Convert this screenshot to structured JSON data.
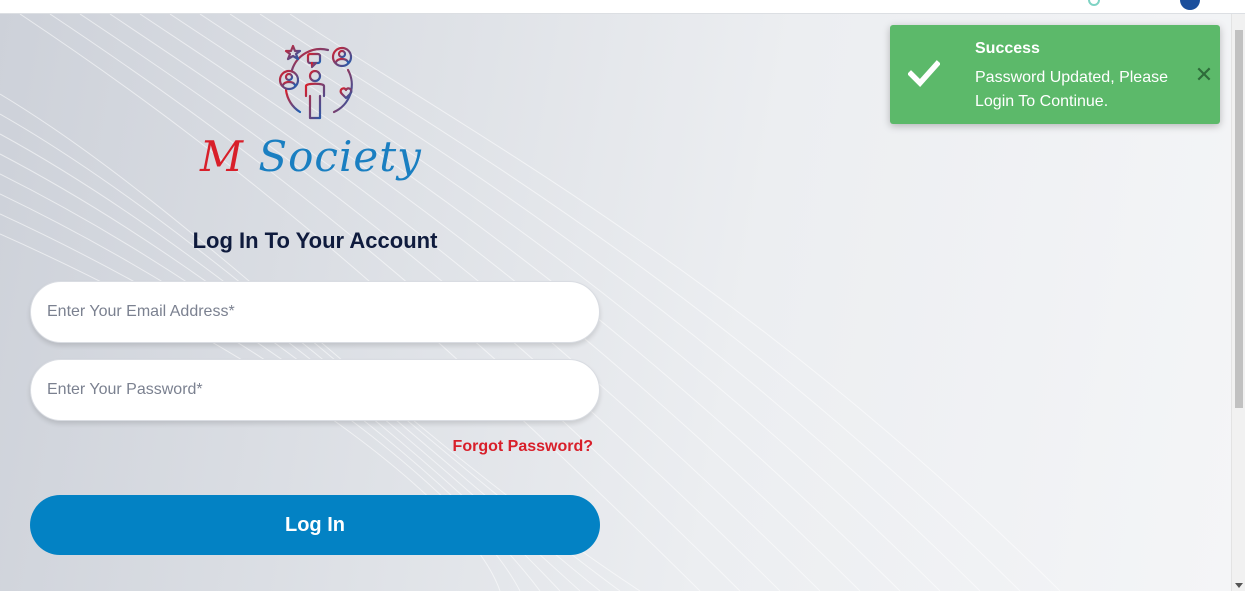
{
  "brand": {
    "initial": "M",
    "name": "Society",
    "logo_icon": "community-people-icon",
    "colors": {
      "red": "#d81f2a",
      "blue": "#1a7fc1"
    }
  },
  "login": {
    "heading": "Log In To Your Account",
    "email_placeholder": "Enter Your Email Address*",
    "email_value": "",
    "password_placeholder": "Enter Your Password*",
    "password_value": "",
    "forgot_label": "Forgot Password?",
    "submit_label": "Log In",
    "accent_color": "#0382c4"
  },
  "toast": {
    "title": "Success",
    "message": "Password Updated, Please Login To Continue.",
    "icon": "checkmark-icon",
    "close_icon": "close-icon",
    "color": "#5cb96a"
  }
}
